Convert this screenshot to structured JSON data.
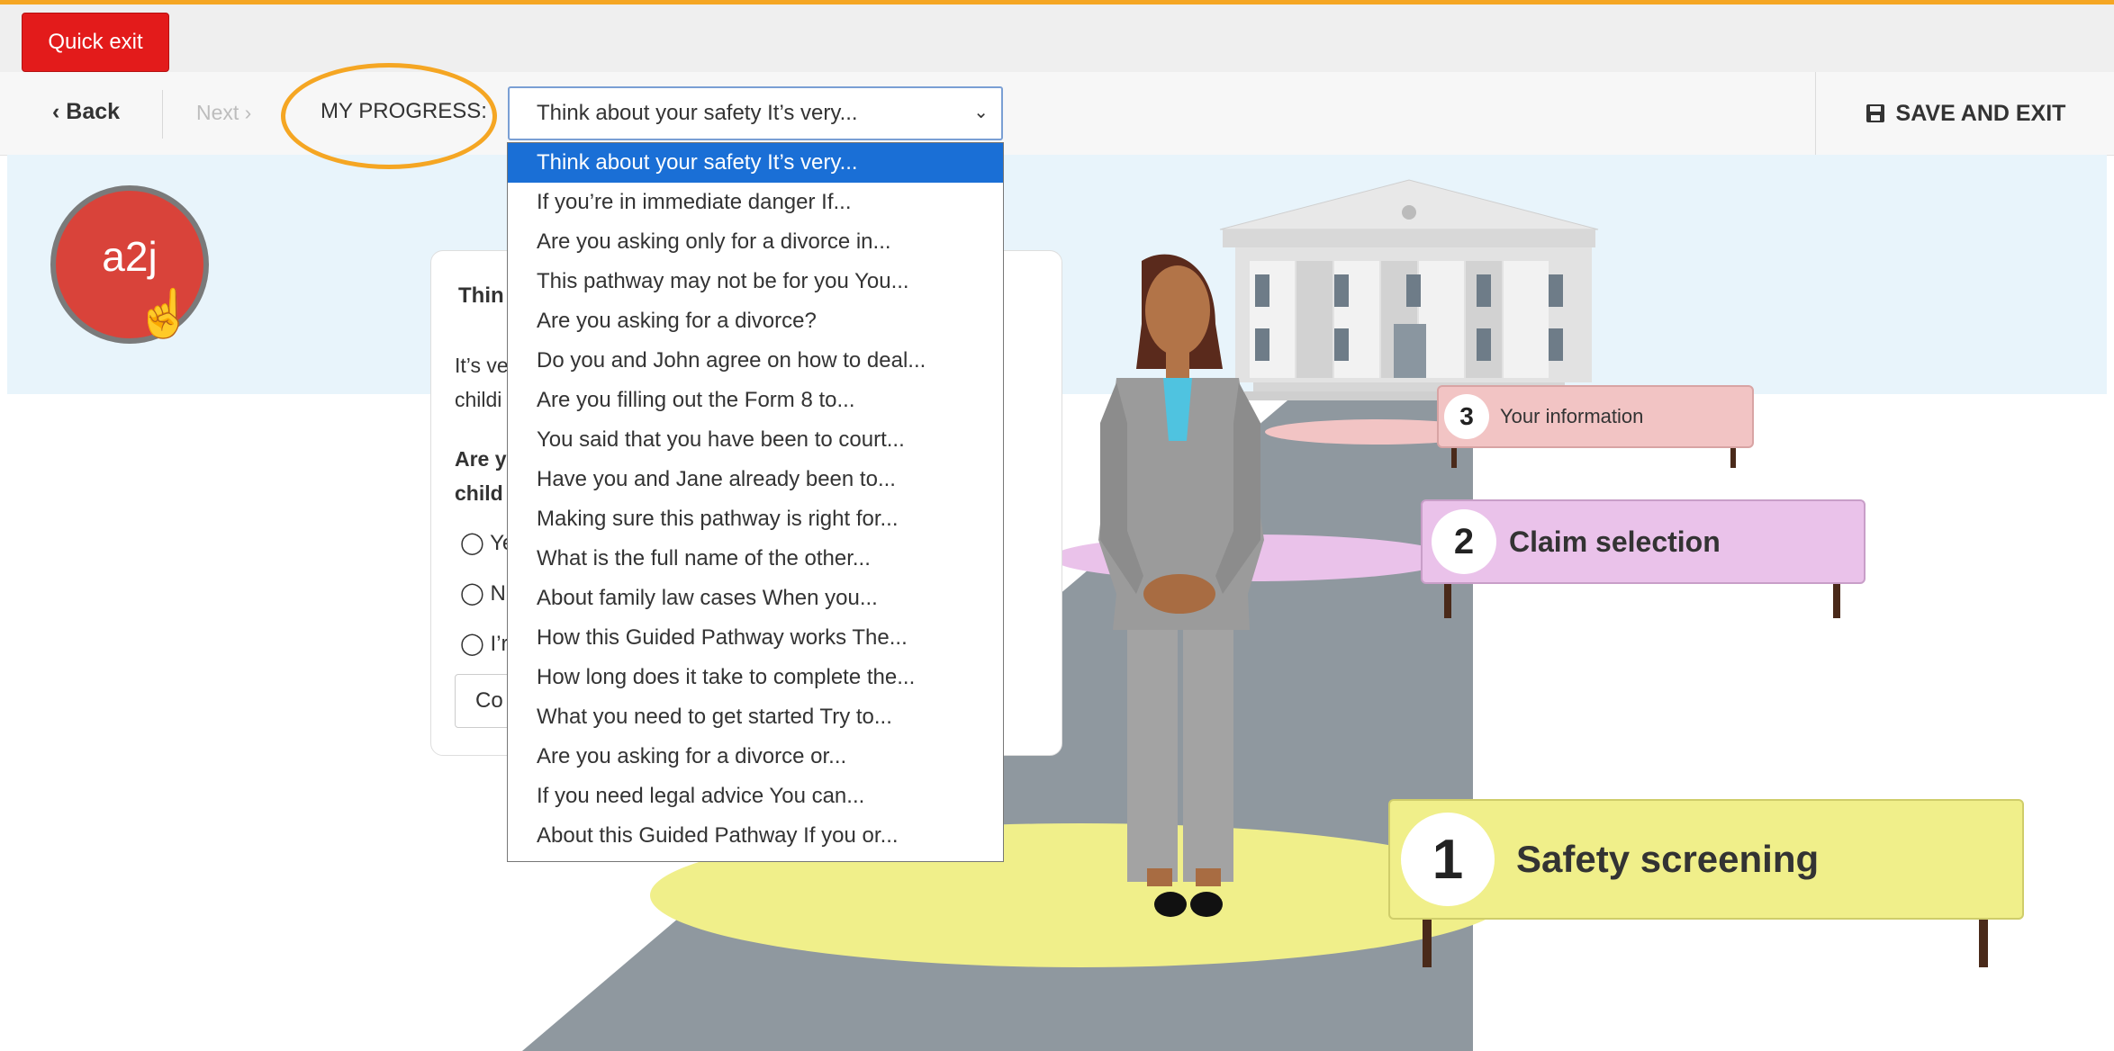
{
  "header": {
    "quick_exit": "Quick exit"
  },
  "nav": {
    "back": "‹ Back",
    "next": "Next ›",
    "progress_label": "MY PROGRESS:",
    "save_exit": "SAVE AND EXIT"
  },
  "progress_select": {
    "selected": "Think about your safety It’s very...",
    "options": [
      "Think about your safety It’s very...",
      "If you’re in immediate danger If...",
      "Are you asking only for a divorce in...",
      "This pathway may not be for you You...",
      "Are you asking for a divorce?",
      "Do you and John agree on how to deal...",
      "Are you filling out the Form 8 to...",
      "You said that you have been to court...",
      "Have you and Jane already been to...",
      "Making sure this pathway is right for...",
      "What is the full name of the other...",
      "About family law cases When you...",
      "How this Guided Pathway works The...",
      "How long does it take to complete the...",
      "What you need to get started   Try to...",
      "Are you asking for a divorce or...",
      "If you need legal advice You can...",
      "About this Guided Pathway If you or..."
    ]
  },
  "logo": {
    "text": "a2j"
  },
  "question_card": {
    "title": "Thin",
    "text_line1": "It’s ve",
    "text_line2": "childi",
    "question_line1": "Are y",
    "question_line2": "child",
    "options": [
      "Ye",
      "N",
      "I’r"
    ],
    "continue": "Co"
  },
  "stages": [
    {
      "number": "1",
      "label": "Safety screening"
    },
    {
      "number": "2",
      "label": "Claim selection"
    },
    {
      "number": "3",
      "label": "Your information"
    }
  ],
  "colors": {
    "quick_exit": "#e31b1b",
    "highlight": "#f5a623",
    "dropdown_selected": "#1a6fd6",
    "stage1": "#f0ef8a",
    "stage2": "#eac2ea",
    "stage3": "#f2c4c4"
  }
}
